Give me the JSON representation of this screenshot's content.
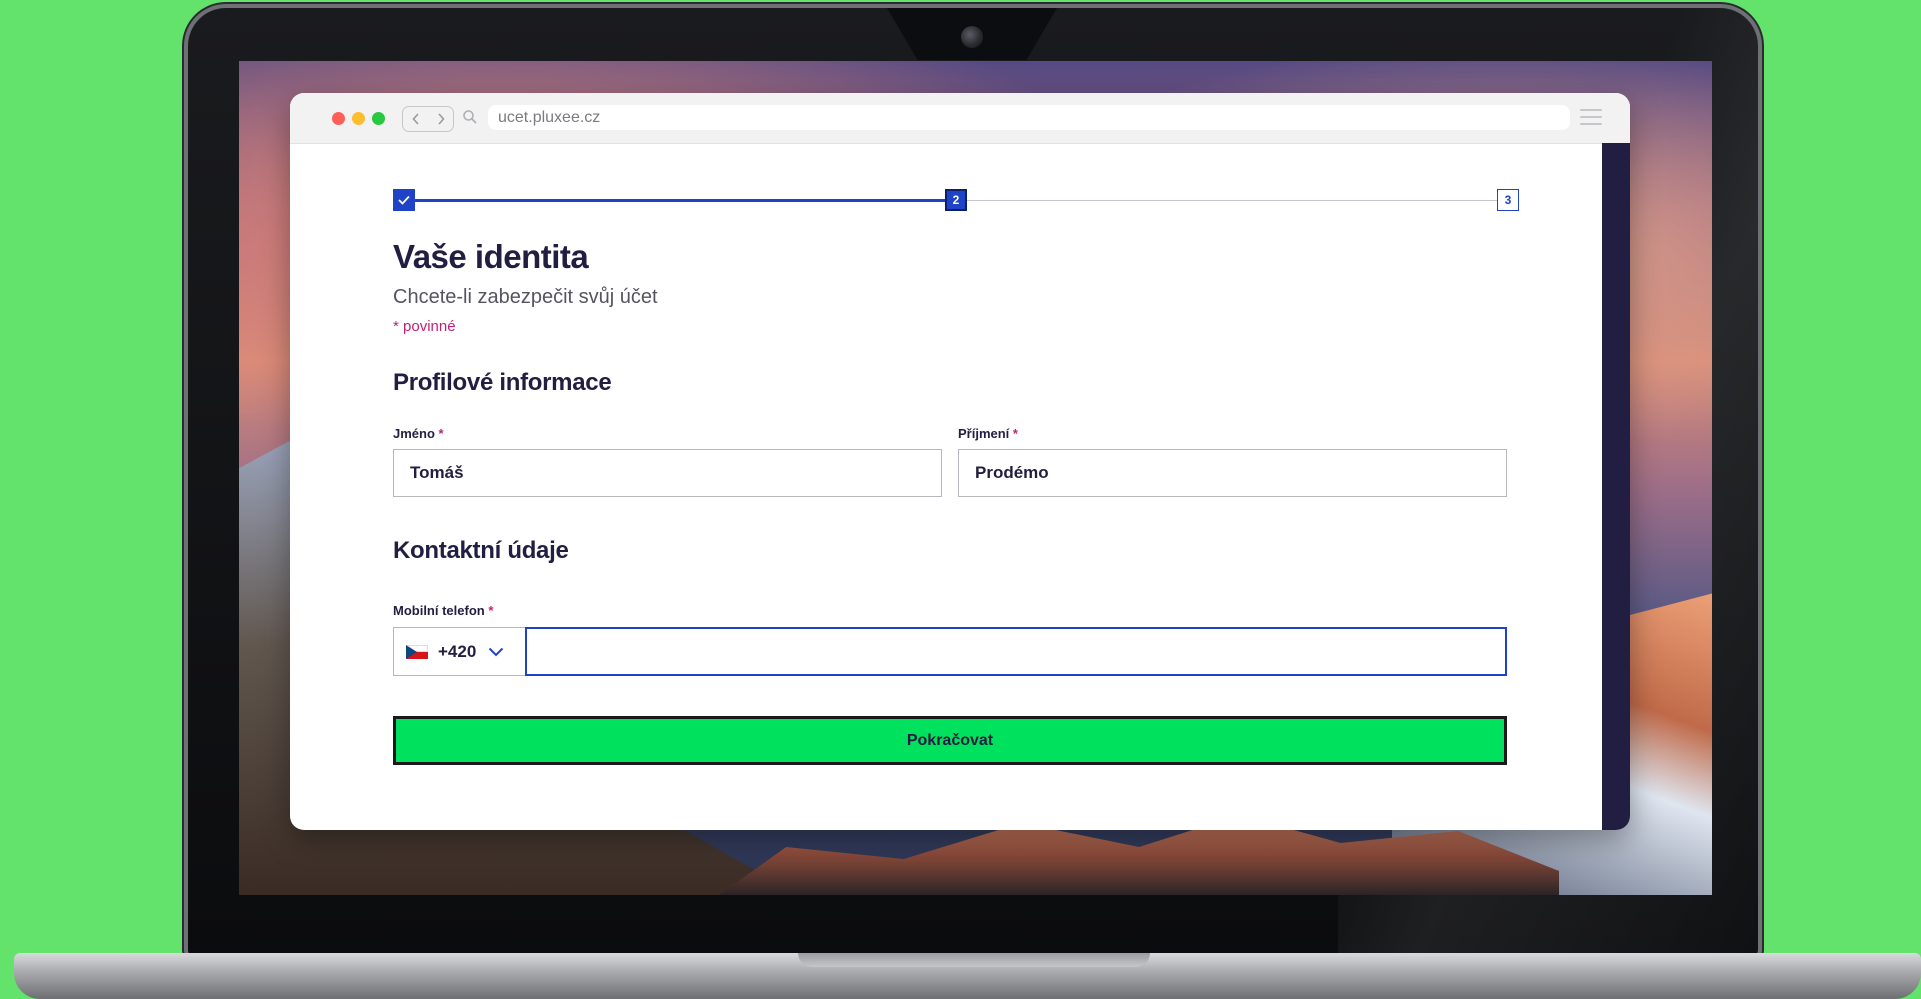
{
  "browser": {
    "url": "ucet.pluxee.cz"
  },
  "stepper": {
    "steps": [
      {
        "label": "",
        "state": "done",
        "icon": "check-icon"
      },
      {
        "label": "2",
        "state": "current"
      },
      {
        "label": "3",
        "state": "upcoming"
      }
    ]
  },
  "page": {
    "title": "Vaše identita",
    "subtitle": "Chcete-li zabezpečit svůj účet",
    "required_note": "* povinné"
  },
  "profile_section": {
    "heading": "Profilové informace",
    "first_name": {
      "label": "Jméno",
      "required_mark": "*",
      "value": "Tomáš"
    },
    "last_name": {
      "label": "Příjmení",
      "required_mark": "*",
      "value": "Prodémo"
    }
  },
  "contact_section": {
    "heading": "Kontaktní údaje",
    "phone": {
      "label": "Mobilní telefon",
      "required_mark": "*",
      "country_flag": "czech-flag-icon",
      "dial_code": "+420",
      "value": ""
    }
  },
  "actions": {
    "continue_label": "Pokračovat"
  },
  "colors": {
    "primary_blue": "#1f43c7",
    "accent_pink": "#c41f78",
    "button_green": "#00e25d",
    "text_dark": "#221e41",
    "background": "#63e36b"
  }
}
